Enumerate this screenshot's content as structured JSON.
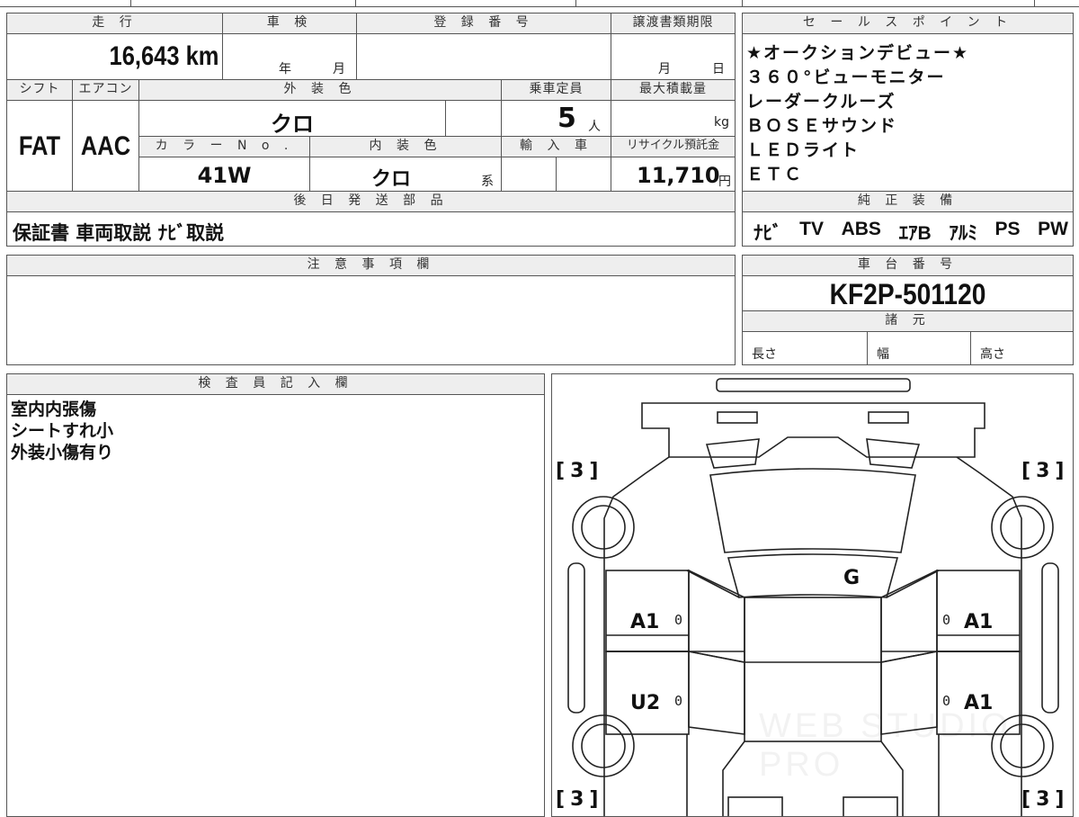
{
  "vehicle": {
    "mileage_label": "走 行",
    "mileage": "16,643 km",
    "inspection_label": "車 検",
    "inspection_year_unit": "年",
    "inspection_month_unit": "月",
    "registration_label": "登 録 番 号",
    "transfer_deadline_label": "譲渡書類期限",
    "transfer_month_unit": "月",
    "transfer_day_unit": "日",
    "shift_label": "シフト",
    "shift": "FAT",
    "aircon_label": "エアコン",
    "aircon": "AAC",
    "exterior_color_label": "外 装 色",
    "exterior_color": "クロ",
    "capacity_label": "乗車定員",
    "capacity": "5",
    "capacity_unit": "人",
    "max_load_label": "最大積載量",
    "max_load_unit": "kg",
    "color_no_label": "カ ラ ー N o .",
    "color_no": "41W",
    "interior_color_label": "内 装 色",
    "interior_color": "クロ",
    "interior_suffix": "系",
    "import_label": "輸 入 車",
    "recycle_label": "リサイクル預託金",
    "recycle_fee": "11,710",
    "recycle_unit": "円",
    "later_parts_label": "後 日 発 送 部 品",
    "later_parts": "保証書 車両取説 ﾅﾋﾞ取説"
  },
  "sales_points": {
    "label": "セ ー ル ス ポ イ ン ト",
    "items": [
      "★オークションデビュー★",
      "３６０°ビューモニター",
      "レーダークルーズ",
      "ＢＯＳＥサウンド",
      "ＬＥＤライト",
      "ＥＴＣ"
    ]
  },
  "genuine_equipment": {
    "label": "純 正 装 備",
    "items": [
      "ﾅﾋﾞ",
      "TV",
      "ABS",
      "ｴｱB",
      "ｱﾙﾐ",
      "PS",
      "PW"
    ]
  },
  "caution": {
    "label": "注 意 事 項 欄"
  },
  "chassis": {
    "label": "車 台 番 号",
    "number": "KF2P-501120"
  },
  "specs": {
    "label": "諸 元",
    "length_label": "長さ",
    "width_label": "幅",
    "height_label": "高さ"
  },
  "inspector": {
    "label": "検 査 員 記 入 欄",
    "notes": [
      "室内内張傷",
      "シートすれ小",
      "外装小傷有り"
    ]
  },
  "diagram": {
    "tire_bracket_open": "[",
    "tire_bracket_close": "]",
    "tire_tl": "3",
    "tire_tr": "3",
    "tire_bl": "3",
    "tire_br": "3",
    "glass_mark": "G",
    "front_left_door": "A1",
    "front_right_door": "A1",
    "rear_left_door": "U2",
    "rear_right_door": "A1",
    "zero": "0",
    "watermark": "WEB STUDIO PRO"
  }
}
